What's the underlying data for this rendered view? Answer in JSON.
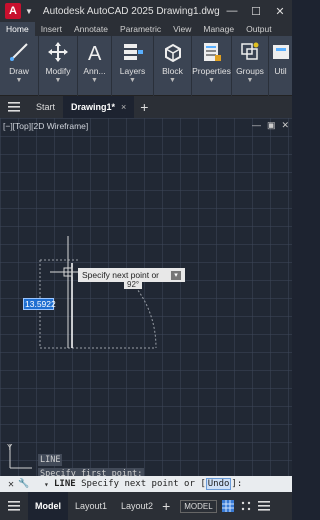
{
  "titlebar": {
    "app_letter": "A",
    "title": "Autodesk AutoCAD 2025   Drawing1.dwg",
    "minimize": "—",
    "maximize": "☐",
    "close": "✕"
  },
  "ribbon": {
    "tabs": [
      "Home",
      "Insert",
      "Annotate",
      "Parametric",
      "View",
      "Manage",
      "Output"
    ],
    "groups": [
      {
        "label": "Draw",
        "icon": "draw-icon"
      },
      {
        "label": "Modify",
        "icon": "move-icon"
      },
      {
        "label": "Ann...",
        "icon": "annotation-icon"
      },
      {
        "label": "Layers",
        "icon": "layers-icon"
      },
      {
        "label": "Block",
        "icon": "block-icon"
      },
      {
        "label": "Properties",
        "icon": "properties-icon"
      },
      {
        "label": "Groups",
        "icon": "groups-icon"
      },
      {
        "label": "Util",
        "icon": "utilities-icon"
      }
    ]
  },
  "filetabs": {
    "start": "Start",
    "drawing": "Drawing1*",
    "close": "×",
    "new": "+"
  },
  "viewport": {
    "label": "[−][Top][2D Wireframe]"
  },
  "tooltip": {
    "prompt": "Specify next point or",
    "angle": "92°"
  },
  "dynamic_input": {
    "length": "13.5922"
  },
  "command_history": [
    "LINE",
    "Specify first point:"
  ],
  "command_line": {
    "command": "LINE",
    "prompt": "Specify next point or [",
    "option": "Undo",
    "suffix": "]:"
  },
  "statusbar": {
    "tabs": [
      "Model",
      "Layout1",
      "Layout2"
    ],
    "add": "+",
    "model_button": "MODEL"
  }
}
